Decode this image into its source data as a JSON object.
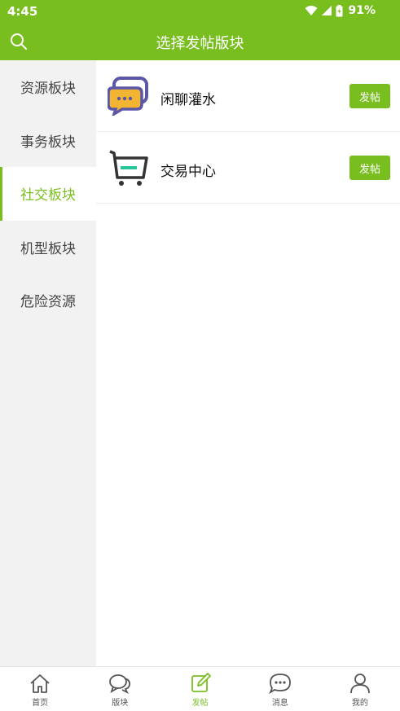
{
  "status_bar": {
    "time": "4:45",
    "battery": "91%",
    "icons": [
      "wifi-icon",
      "signal-icon",
      "battery-icon"
    ]
  },
  "app_bar": {
    "title": "选择发帖版块",
    "search_icon": "search-icon"
  },
  "sidebar": {
    "items": [
      {
        "label": "资源板块",
        "active": false
      },
      {
        "label": "事务板块",
        "active": false
      },
      {
        "label": "社交板块",
        "active": true
      },
      {
        "label": "机型板块",
        "active": false
      },
      {
        "label": "危险资源",
        "active": false
      }
    ]
  },
  "boards": [
    {
      "name": "闲聊灌水",
      "icon": "chat-bubbles-icon",
      "button_label": "发帖"
    },
    {
      "name": "交易中心",
      "icon": "shopping-cart-icon",
      "button_label": "发帖"
    }
  ],
  "tabbar": {
    "items": [
      {
        "label": "首页",
        "icon": "home-icon",
        "active": false
      },
      {
        "label": "版块",
        "icon": "forum-icon",
        "active": false
      },
      {
        "label": "发帖",
        "icon": "edit-icon",
        "active": true
      },
      {
        "label": "消息",
        "icon": "message-icon",
        "active": false
      },
      {
        "label": "我的",
        "icon": "user-icon",
        "active": false
      }
    ]
  },
  "colors": {
    "accent": "#79be1f",
    "sidebar_bg": "#f2f2f2",
    "text_dark": "#111111"
  }
}
